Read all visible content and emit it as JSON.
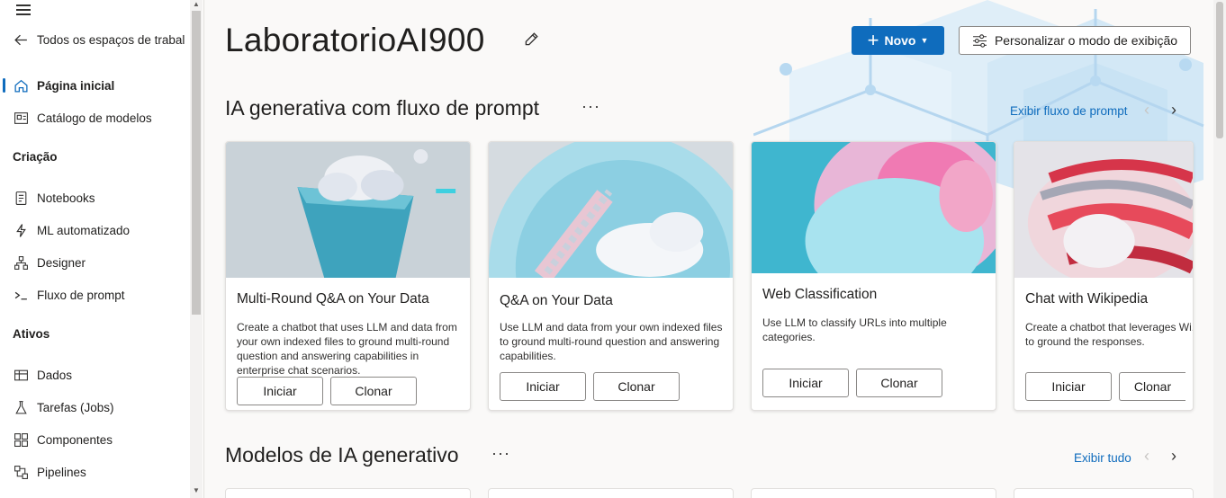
{
  "sidebar": {
    "back_label": "Todos os espaços de trabal",
    "items_top": [
      {
        "label": "Página inicial",
        "icon": "home-icon",
        "active": true
      },
      {
        "label": "Catálogo de modelos",
        "icon": "catalog-icon"
      }
    ],
    "section_creation": "Criação",
    "items_creation": [
      {
        "label": "Notebooks",
        "icon": "notebook-icon"
      },
      {
        "label": "ML automatizado",
        "icon": "automl-icon"
      },
      {
        "label": "Designer",
        "icon": "designer-icon"
      },
      {
        "label": "Fluxo de prompt",
        "icon": "prompt-flow-icon"
      }
    ],
    "section_assets": "Ativos",
    "items_assets": [
      {
        "label": "Dados",
        "icon": "data-icon"
      },
      {
        "label": "Tarefas (Jobs)",
        "icon": "jobs-icon"
      },
      {
        "label": "Componentes",
        "icon": "components-icon"
      },
      {
        "label": "Pipelines",
        "icon": "pipelines-icon"
      }
    ]
  },
  "header": {
    "title": "LaboratorioAI900",
    "new_button": "Novo",
    "customize_button": "Personalizar o modo de exibição"
  },
  "prompt_flow_section": {
    "title": "IA generativa com fluxo de prompt",
    "link": "Exibir fluxo de prompt",
    "cards": [
      {
        "title": "Multi-Round Q&A on Your Data",
        "description": "Create a chatbot that uses LLM and data from your own indexed files to ground multi-round question and answering capabilities in enterprise chat scenarios.",
        "start": "Iniciar",
        "clone": "Clonar"
      },
      {
        "title": "Q&A on Your Data",
        "description": "Use LLM and data from your own indexed files to ground multi-round question and answering capabilities.",
        "start": "Iniciar",
        "clone": "Clonar"
      },
      {
        "title": "Web Classification",
        "description": "Use LLM to classify URLs into multiple categories.",
        "start": "Iniciar",
        "clone": "Clonar"
      },
      {
        "title": "Chat with Wikipedia",
        "description": "Create a chatbot that leverages Wi...",
        "description_line2": "to ground the responses.",
        "start": "Iniciar",
        "clone": "Clonar"
      }
    ]
  },
  "models_section": {
    "title": "Modelos de IA generativo",
    "link": "Exibir tudo"
  },
  "colors": {
    "accent": "#0f6cbd",
    "link": "#0f6cbd"
  }
}
